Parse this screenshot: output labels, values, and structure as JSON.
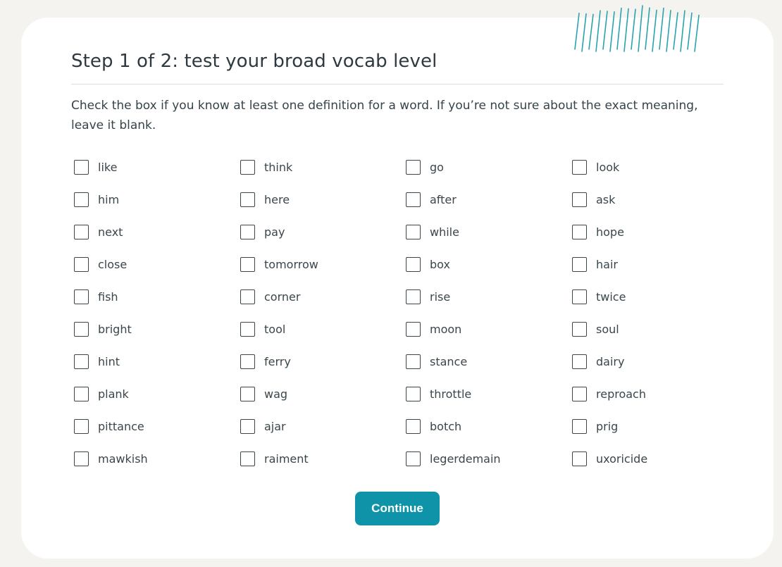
{
  "page": {
    "title": "Step 1 of 2: test your broad vocab level",
    "instructions": "Check the box if you know at least one definition for a word. If you’re not sure about the exact meaning, leave it blank.",
    "continue_label": "Continue"
  },
  "colors": {
    "accent": "#0f93a8",
    "background": "#f4f3ef",
    "card": "#ffffff",
    "text": "#2e3a40"
  },
  "decoration": "diagonal-teal-stripes",
  "words": [
    {
      "label": "like",
      "checked": false
    },
    {
      "label": "think",
      "checked": false
    },
    {
      "label": "go",
      "checked": false
    },
    {
      "label": "look",
      "checked": false
    },
    {
      "label": "him",
      "checked": false
    },
    {
      "label": "here",
      "checked": false
    },
    {
      "label": "after",
      "checked": false
    },
    {
      "label": "ask",
      "checked": false
    },
    {
      "label": "next",
      "checked": false
    },
    {
      "label": "pay",
      "checked": false
    },
    {
      "label": "while",
      "checked": false
    },
    {
      "label": "hope",
      "checked": false
    },
    {
      "label": "close",
      "checked": false
    },
    {
      "label": "tomorrow",
      "checked": false
    },
    {
      "label": "box",
      "checked": false
    },
    {
      "label": "hair",
      "checked": false
    },
    {
      "label": "fish",
      "checked": false
    },
    {
      "label": "corner",
      "checked": false
    },
    {
      "label": "rise",
      "checked": false
    },
    {
      "label": "twice",
      "checked": false
    },
    {
      "label": "bright",
      "checked": false
    },
    {
      "label": "tool",
      "checked": false
    },
    {
      "label": "moon",
      "checked": false
    },
    {
      "label": "soul",
      "checked": false
    },
    {
      "label": "hint",
      "checked": false
    },
    {
      "label": "ferry",
      "checked": false
    },
    {
      "label": "stance",
      "checked": false
    },
    {
      "label": "dairy",
      "checked": false
    },
    {
      "label": "plank",
      "checked": false
    },
    {
      "label": "wag",
      "checked": false
    },
    {
      "label": "throttle",
      "checked": false
    },
    {
      "label": "reproach",
      "checked": false
    },
    {
      "label": "pittance",
      "checked": false
    },
    {
      "label": "ajar",
      "checked": false
    },
    {
      "label": "botch",
      "checked": false
    },
    {
      "label": "prig",
      "checked": false
    },
    {
      "label": "mawkish",
      "checked": false
    },
    {
      "label": "raiment",
      "checked": false
    },
    {
      "label": "legerdemain",
      "checked": false
    },
    {
      "label": "uxoricide",
      "checked": false
    }
  ]
}
